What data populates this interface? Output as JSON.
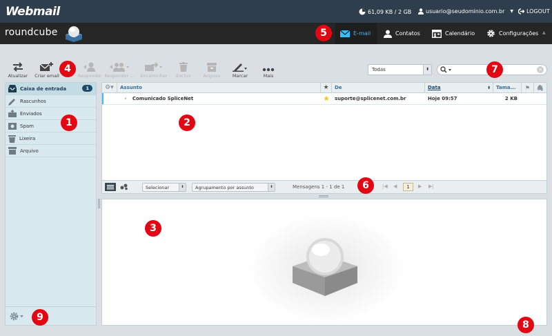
{
  "topbar": {
    "brand": "Webmail",
    "quota": "61,09 KB / 2 GB",
    "user": "usuario@seudominio.com.br",
    "logout": "LOGOUT"
  },
  "navbar": {
    "logo": "roundcube",
    "items": [
      {
        "label": "E-mail",
        "active": true
      },
      {
        "label": "Contatos"
      },
      {
        "label": "Calendário"
      },
      {
        "label": "Configurações"
      }
    ]
  },
  "toolbar": {
    "buttons": [
      {
        "label": "Atualizar",
        "icon": "refresh-icon",
        "enabled": true
      },
      {
        "label": "Criar email",
        "icon": "compose-icon",
        "enabled": true
      },
      {
        "label": "Responder",
        "icon": "reply-icon",
        "enabled": false
      },
      {
        "label": "Responder ...",
        "icon": "reply-all-icon",
        "enabled": false
      },
      {
        "label": "Encaminhar",
        "icon": "forward-icon",
        "enabled": false
      },
      {
        "label": "Excluir",
        "icon": "trash-icon",
        "enabled": false
      },
      {
        "label": "Arquivo",
        "icon": "archive-icon",
        "enabled": false
      },
      {
        "label": "Marcar",
        "icon": "mark-icon",
        "enabled": true
      },
      {
        "label": "Mais",
        "icon": "more-icon",
        "enabled": true
      }
    ],
    "filter_value": "Todas",
    "search_placeholder": ""
  },
  "folders": {
    "items": [
      {
        "label": "Caixa de entrada",
        "icon": "inbox-icon",
        "selected": true,
        "count": "1"
      },
      {
        "label": "Rascunhos",
        "icon": "pencil-icon"
      },
      {
        "label": "Enviados",
        "icon": "sent-icon"
      },
      {
        "label": "Spam",
        "icon": "spam-icon"
      },
      {
        "label": "Lixeira",
        "icon": "trash-icon"
      },
      {
        "label": "Arquivo",
        "icon": "archive-icon"
      }
    ]
  },
  "messagelist": {
    "columns": {
      "subject": "Assunto",
      "from": "De",
      "date": "Data",
      "size": "Tama..."
    },
    "rows": [
      {
        "subject": "Comunicado SpliceNet",
        "from": "suporte@splicenet.com.br",
        "date": "Hoje 09:57",
        "size": "2 KB",
        "flagged": true
      }
    ],
    "footer": {
      "select_label": "Selecionar",
      "threads_label": "Agrupamento por assunto",
      "count_text": "Mensagens 1 - 1 de 1",
      "page": "1"
    }
  },
  "markers": [
    "1",
    "2",
    "3",
    "4",
    "5",
    "6",
    "7",
    "8",
    "9"
  ],
  "colors": {
    "marker": "#e30613",
    "topbar": "#2f3e4c",
    "navbar": "#262626",
    "accent": "#37beff"
  }
}
